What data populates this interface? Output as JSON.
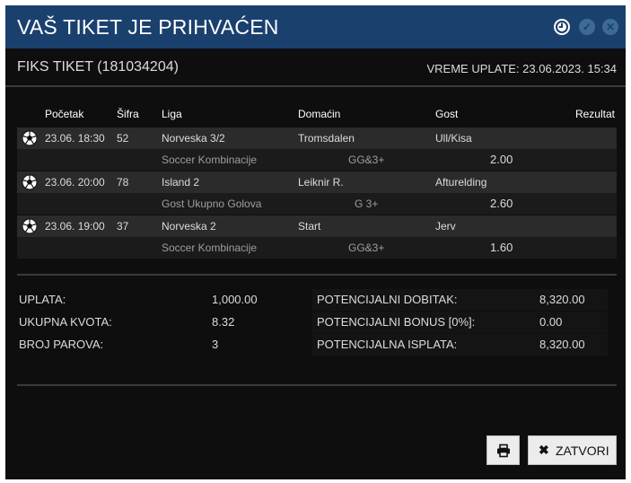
{
  "header": {
    "title": "VAŠ TIKET JE PRIHVAĆEN",
    "icons": [
      "clock-icon",
      "check-circle-icon",
      "close-circle-icon"
    ]
  },
  "ticket": {
    "title": "FIKS TIKET (181034204)",
    "payment_time": "VREME UPLATE: 23.06.2023. 15:34"
  },
  "table": {
    "headers": [
      "Početak",
      "Šifra",
      "Liga",
      "Domaćin",
      "Gost",
      "Rezultat"
    ],
    "rows": [
      {
        "sport_icon": "soccer-ball-icon",
        "start": "23.06. 18:30",
        "code": "52",
        "league": "Norveska 3/2",
        "home": "Tromsdalen",
        "away": "Ull/Kisa",
        "result": "",
        "bet_type": "Soccer Kombinacije",
        "pick": "GG&3+",
        "odd": "2.00"
      },
      {
        "sport_icon": "soccer-ball-icon",
        "start": "23.06. 20:00",
        "code": "78",
        "league": "Island 2",
        "home": "Leiknir R.",
        "away": "Afturelding",
        "result": "",
        "bet_type": "Gost Ukupno Golova",
        "pick": "G 3+",
        "odd": "2.60"
      },
      {
        "sport_icon": "soccer-ball-icon",
        "start": "23.06. 19:00",
        "code": "37",
        "league": "Norveska 2",
        "home": "Start",
        "away": "Jerv",
        "result": "",
        "bet_type": "Soccer Kombinacije",
        "pick": "GG&3+",
        "odd": "1.60"
      }
    ]
  },
  "summary": {
    "left": [
      {
        "label": "UPLATA:",
        "value": "1,000.00"
      },
      {
        "label": "UKUPNA KVOTA:",
        "value": "8.32"
      },
      {
        "label": "BROJ PAROVA:",
        "value": "3"
      }
    ],
    "right": [
      {
        "label": "POTENCIJALNI DOBITAK:",
        "value": "8,320.00"
      },
      {
        "label": "POTENCIJALNI BONUS [0%]:",
        "value": "0.00"
      },
      {
        "label": "POTENCIJALNA ISPLATA:",
        "value": "8,320.00"
      }
    ]
  },
  "buttons": {
    "print_icon": "printer-icon",
    "close_icon": "close-x-icon",
    "close_label": "ZATVORI"
  },
  "colors": {
    "header_bg": "#1a416e",
    "panel_bg": "#0e0e0e",
    "row_bg": "#2b2b2b",
    "subrow_bg": "#1b1b1b",
    "button_bg": "#ececec"
  }
}
